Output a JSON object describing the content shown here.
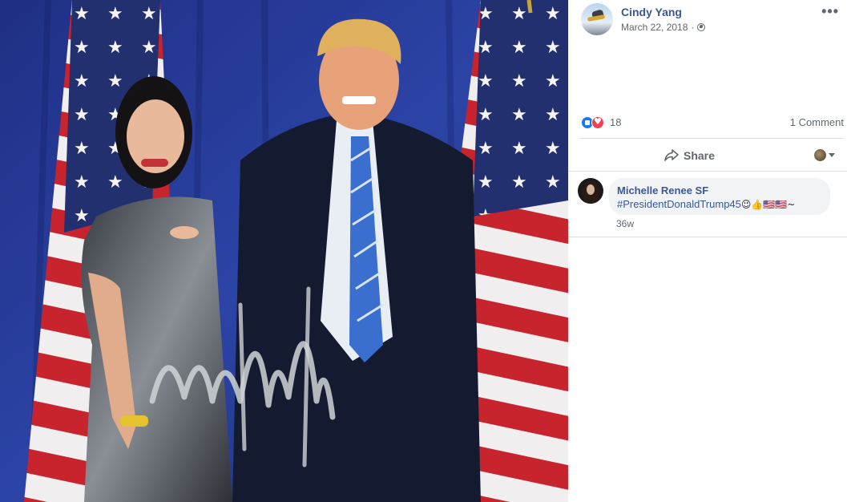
{
  "post": {
    "author": "Cindy Yang",
    "date": "March 22, 2018",
    "privacy_icon": "globe-icon",
    "more_label": "•••",
    "reaction_count": "18",
    "reactions": [
      "like",
      "love"
    ],
    "comment_count_label": "1 Comment",
    "share_label": "Share"
  },
  "comment": {
    "author": "Michelle Renee SF",
    "text": "#PresidentDonaldTrump45",
    "emojis": "😉👍🇺🇸🇺🇸~",
    "time": "36w"
  },
  "colors": {
    "link_blue": "#385898",
    "meta_gray": "#606770",
    "divider": "#dadde1",
    "bubble_bg": "#f2f3f5",
    "photo_backdrop": "#1c2f82"
  }
}
